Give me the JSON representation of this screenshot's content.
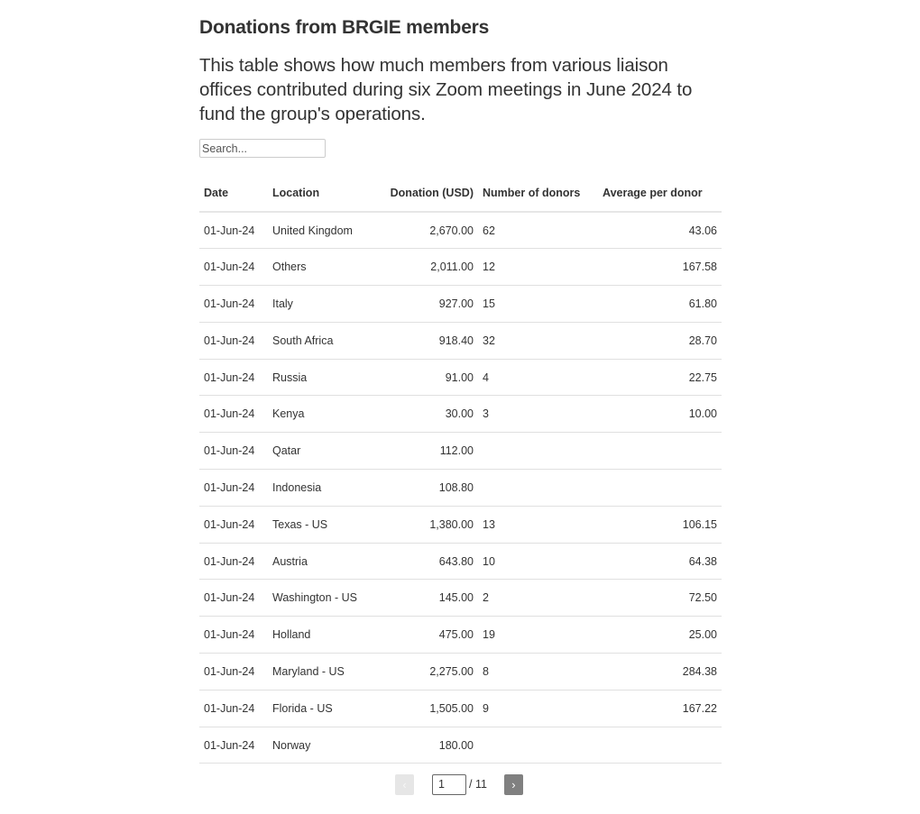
{
  "header": {
    "title": "Donations from BRGIE members",
    "description": "This table shows how much members from various liaison offices contributed during six Zoom meetings in June 2024 to fund the group's operations."
  },
  "search": {
    "placeholder": "Search...",
    "value": ""
  },
  "table": {
    "columns": [
      "Date",
      "Location",
      "Donation (USD)",
      "Number of donors",
      "Average per donor"
    ],
    "rows": [
      {
        "date": "01-Jun-24",
        "location": "United Kingdom",
        "donation": "2,670.00",
        "donors": "62",
        "average": "43.06"
      },
      {
        "date": "01-Jun-24",
        "location": "Others",
        "donation": "2,011.00",
        "donors": "12",
        "average": "167.58"
      },
      {
        "date": "01-Jun-24",
        "location": "Italy",
        "donation": "927.00",
        "donors": "15",
        "average": "61.80"
      },
      {
        "date": "01-Jun-24",
        "location": "South Africa",
        "donation": "918.40",
        "donors": "32",
        "average": "28.70"
      },
      {
        "date": "01-Jun-24",
        "location": "Russia",
        "donation": "91.00",
        "donors": "4",
        "average": "22.75"
      },
      {
        "date": "01-Jun-24",
        "location": "Kenya",
        "donation": "30.00",
        "donors": "3",
        "average": "10.00"
      },
      {
        "date": "01-Jun-24",
        "location": "Qatar",
        "donation": "112.00",
        "donors": "",
        "average": ""
      },
      {
        "date": "01-Jun-24",
        "location": "Indonesia",
        "donation": "108.80",
        "donors": "",
        "average": ""
      },
      {
        "date": "01-Jun-24",
        "location": "Texas - US",
        "donation": "1,380.00",
        "donors": "13",
        "average": "106.15"
      },
      {
        "date": "01-Jun-24",
        "location": "Austria",
        "donation": "643.80",
        "donors": "10",
        "average": "64.38"
      },
      {
        "date": "01-Jun-24",
        "location": "Washington - US",
        "donation": "145.00",
        "donors": "2",
        "average": "72.50"
      },
      {
        "date": "01-Jun-24",
        "location": "Holland",
        "donation": "475.00",
        "donors": "19",
        "average": "25.00"
      },
      {
        "date": "01-Jun-24",
        "location": "Maryland - US",
        "donation": "2,275.00",
        "donors": "8",
        "average": "284.38"
      },
      {
        "date": "01-Jun-24",
        "location": "Florida - US",
        "donation": "1,505.00",
        "donors": "9",
        "average": "167.22"
      },
      {
        "date": "01-Jun-24",
        "location": "Norway",
        "donation": "180.00",
        "donors": "",
        "average": ""
      }
    ]
  },
  "pagination": {
    "prev_icon": "‹",
    "next_icon": "›",
    "current_page": "1",
    "total_label": "/ 11"
  }
}
